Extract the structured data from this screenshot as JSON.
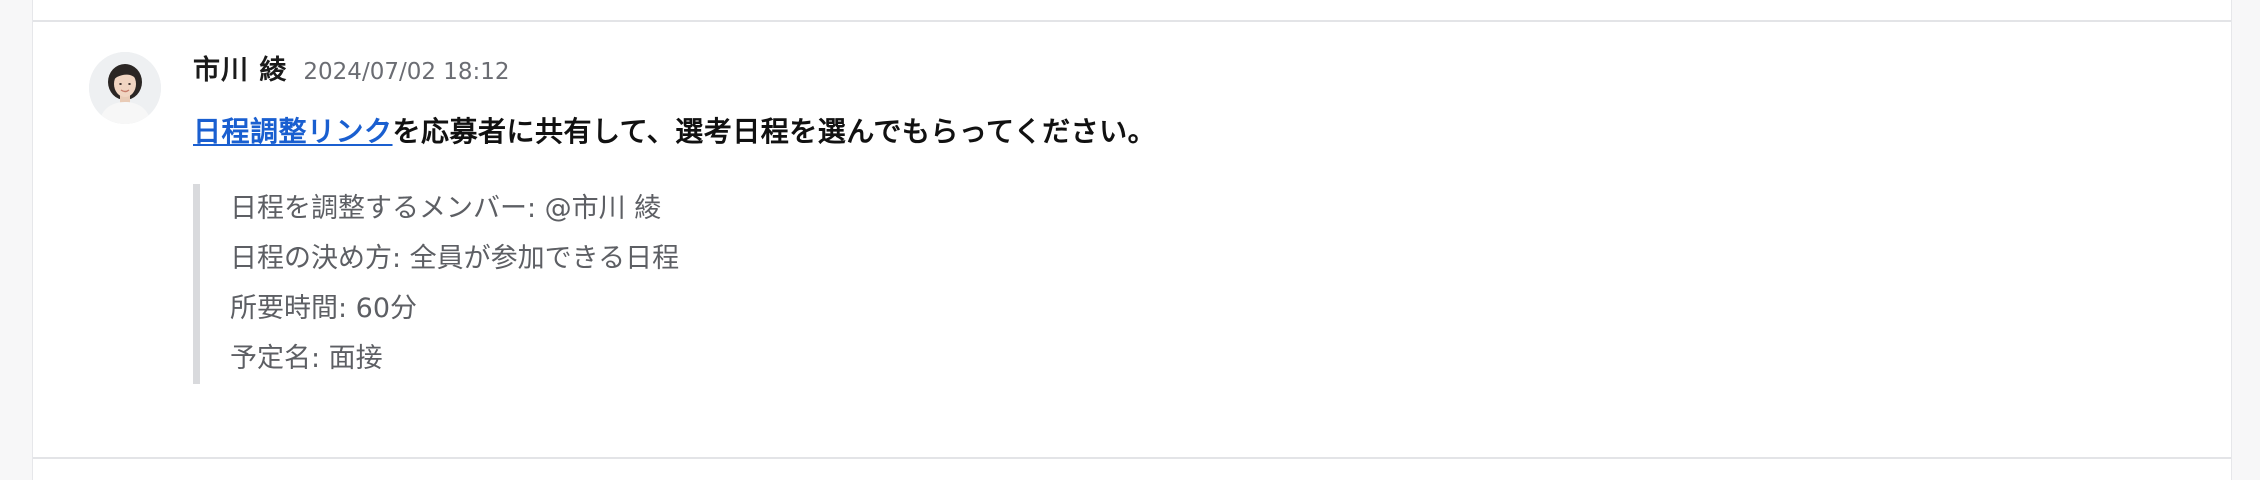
{
  "message": {
    "author": "市川 綾",
    "timestamp": "2024/07/02 18:12",
    "link_text": "日程調整リンク",
    "body_rest": "を応募者に共有して、選考日程を選んでもらってください。",
    "quote_lines": [
      "日程を調整するメンバー: @市川 綾",
      "日程の決め方: 全員が参加できる日程",
      "所要時間: 60分",
      "予定名: 面接"
    ]
  },
  "colors": {
    "link": "#1a5fd0",
    "quote_border": "#d9dadd",
    "quote_text": "#5d5f64"
  }
}
